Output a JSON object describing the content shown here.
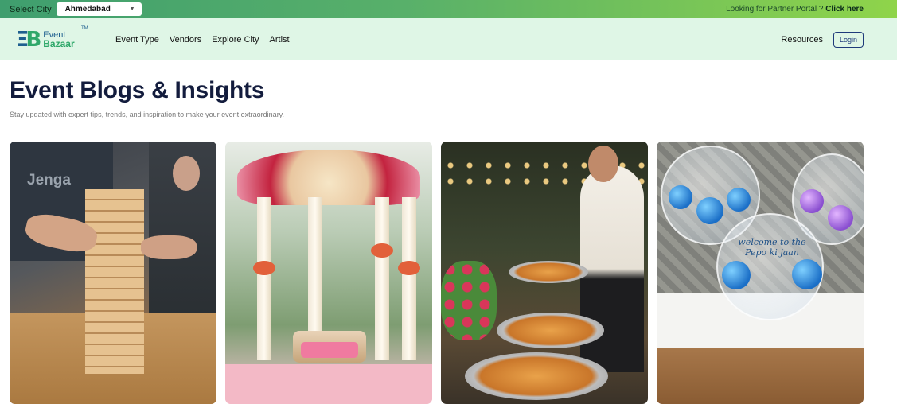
{
  "topbar": {
    "select_city_label": "Select City",
    "city_value": "Ahmedabad",
    "partner_text": "Looking for Partner Portal ?",
    "partner_link": "Click here"
  },
  "nav": {
    "logo_event": "Event",
    "logo_bazaar": "Bazaar",
    "logo_tm": "TM",
    "links": [
      "Event Type",
      "Vendors",
      "Explore City",
      "Artist"
    ],
    "resources": "Resources",
    "login": "Login"
  },
  "page": {
    "title": "Event Blogs & Insights",
    "subtitle": "Stay updated with expert tips, trends, and inspiration to make your event extraordinary."
  },
  "cards": [
    {
      "image": "jenga-game-photo",
      "sign_text": "Jenga"
    },
    {
      "image": "wedding-mandap-photo"
    },
    {
      "image": "buffet-catering-photo"
    },
    {
      "image": "balloon-decor-photo",
      "balloon_text": "welcome to the Pepo ki jaan"
    }
  ],
  "colors": {
    "topbar_start": "#3f9e6e",
    "topbar_end": "#8fd44a",
    "nav_bg": "#dff6e6",
    "brand_blue": "#1e5f8f",
    "brand_green": "#2fa86a",
    "title": "#131c3d"
  }
}
